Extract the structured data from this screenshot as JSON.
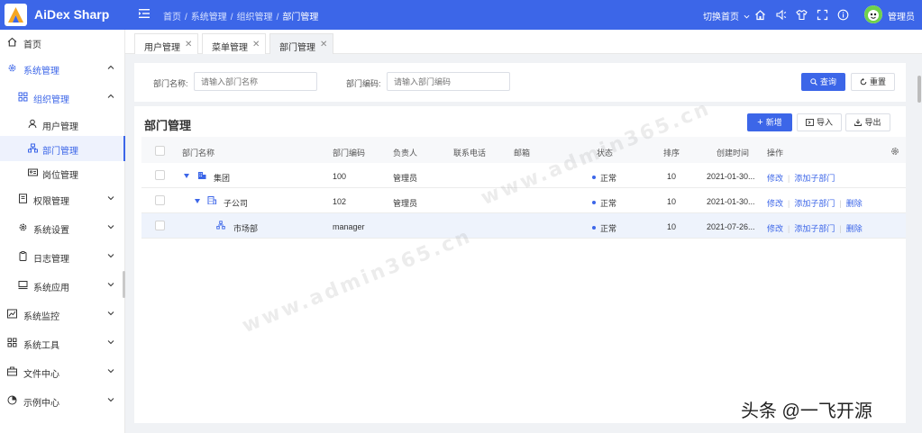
{
  "app": {
    "title": "AiDex Sharp"
  },
  "header": {
    "breadcrumb": [
      "首页",
      "系统管理",
      "组织管理",
      "部门管理"
    ],
    "switch_home": "切换首页",
    "username": "管理员"
  },
  "sidebar": {
    "items": [
      {
        "label": "首页",
        "icon": "home-icon"
      },
      {
        "label": "系统管理",
        "icon": "gear-icon"
      },
      {
        "label": "组织管理",
        "icon": "grid-icon"
      },
      {
        "label": "用户管理",
        "icon": "user-icon"
      },
      {
        "label": "部门管理",
        "icon": "org-icon"
      },
      {
        "label": "岗位管理",
        "icon": "id-card-icon"
      },
      {
        "label": "权限管理",
        "icon": "document-icon"
      },
      {
        "label": "系统设置",
        "icon": "gear-icon"
      },
      {
        "label": "日志管理",
        "icon": "clipboard-icon"
      },
      {
        "label": "系统应用",
        "icon": "monitor-icon"
      },
      {
        "label": "系统监控",
        "icon": "chart-icon"
      },
      {
        "label": "系统工具",
        "icon": "grid-icon"
      },
      {
        "label": "文件中心",
        "icon": "briefcase-icon"
      },
      {
        "label": "示例中心",
        "icon": "pie-icon"
      }
    ]
  },
  "tabs": [
    {
      "label": "用户管理"
    },
    {
      "label": "菜单管理"
    },
    {
      "label": "部门管理"
    }
  ],
  "search": {
    "dept_name_label": "部门名称:",
    "dept_name_placeholder": "请输入部门名称",
    "dept_code_label": "部门编码:",
    "dept_code_placeholder": "请输入部门编码",
    "query_label": "查询",
    "reset_label": "重置"
  },
  "main": {
    "title": "部门管理",
    "add_label": "新增",
    "import_label": "导入",
    "export_label": "导出"
  },
  "table": {
    "columns": [
      "部门名称",
      "部门编码",
      "负责人",
      "联系电话",
      "邮箱",
      "状态",
      "排序",
      "创建时间",
      "操作"
    ],
    "rows": [
      {
        "name": "集团",
        "code": "100",
        "leader": "管理员",
        "phone": "",
        "email": "",
        "status": "正常",
        "sort": "10",
        "created": "2021-01-30...",
        "actions": [
          "修改",
          "添加子部门"
        ]
      },
      {
        "name": "子公司",
        "code": "102",
        "leader": "管理员",
        "phone": "",
        "email": "",
        "status": "正常",
        "sort": "10",
        "created": "2021-01-30...",
        "actions": [
          "修改",
          "添加子部门",
          "删除"
        ]
      },
      {
        "name": "市场部",
        "code": "manager",
        "leader": "",
        "phone": "",
        "email": "",
        "status": "正常",
        "sort": "10",
        "created": "2021-07-26...",
        "actions": [
          "修改",
          "添加子部门",
          "删除"
        ]
      }
    ]
  },
  "watermark": "www.admin365.cn",
  "corner_mark": "头条 @一飞开源",
  "colors": {
    "primary": "#3c66e8",
    "header_bg": "#3c66e8",
    "row_highlight": "#eef3fc"
  }
}
